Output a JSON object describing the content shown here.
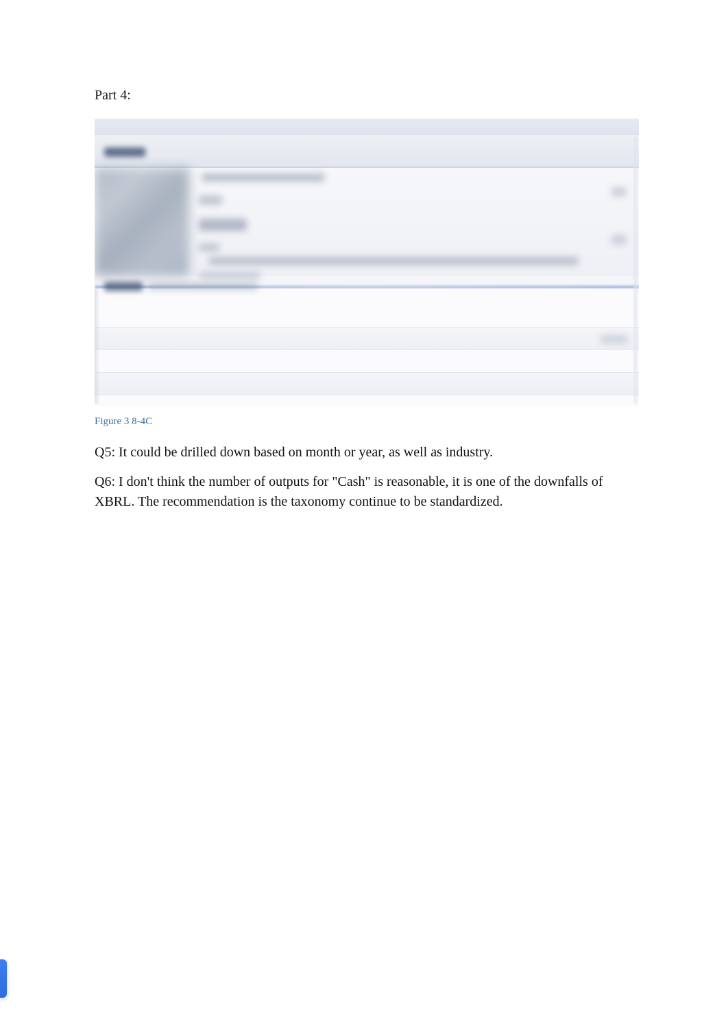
{
  "heading": "Part 4:",
  "figure": {
    "caption": "Figure 3 8-4C"
  },
  "paragraphs": {
    "q5": "Q5: It could be drilled down based on month or year, as well as industry.",
    "q6": "Q6: I don't think the number of outputs for \"Cash\" is reasonable, it is one of the downfalls of XBRL. The recommendation is the taxonomy continue to be standardized."
  }
}
